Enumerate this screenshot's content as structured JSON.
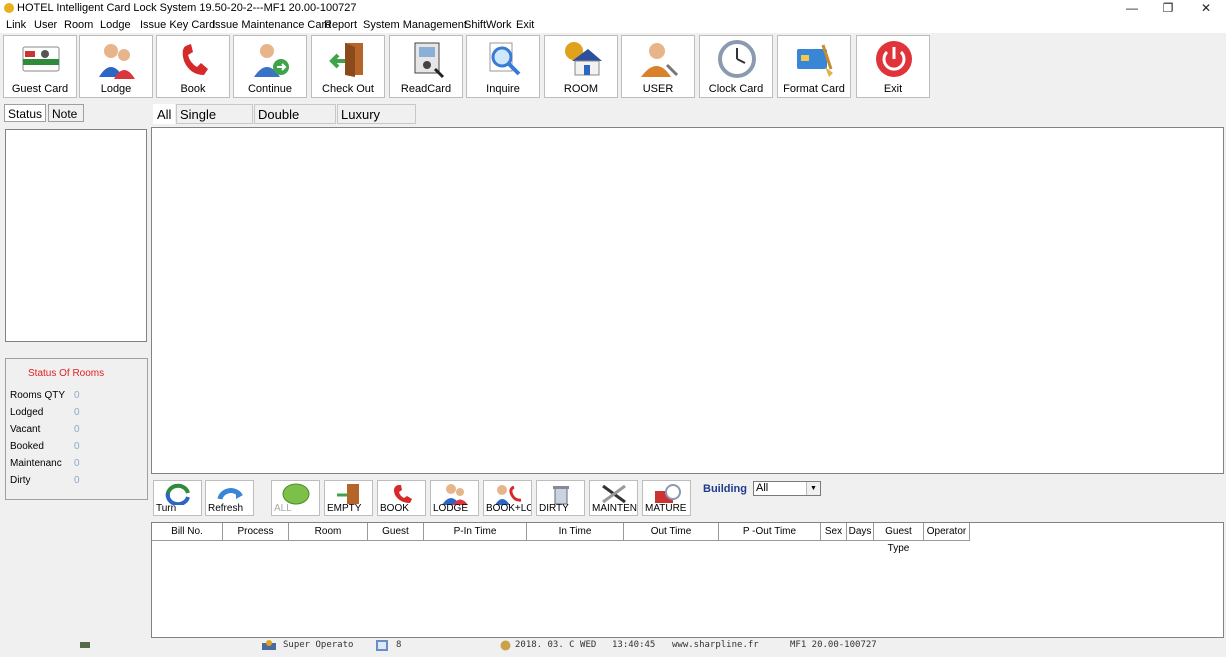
{
  "window": {
    "title": "HOTEL Intelligent Card Lock System 19.50-20-2---MF1 20.00-100727",
    "minimize": "—",
    "restore": "❐",
    "close": "✕"
  },
  "menu": [
    "Link",
    "User",
    "Room",
    "Lodge",
    "Issue Key Card",
    "Issue Maintenance Card",
    "Report",
    "System Management",
    "ShiftWork",
    "Exit"
  ],
  "toolbar": [
    "Guest Card",
    "Lodge",
    "Book",
    "Continue",
    "Check Out",
    "ReadCard",
    "Inquire",
    "ROOM",
    "USER",
    "Clock Card",
    "Format Card",
    "Exit"
  ],
  "left_tabs": [
    "Status",
    "Note"
  ],
  "room_tabs": [
    "All",
    "Single Room",
    "Double Room",
    "Luxury Room"
  ],
  "status_panel": {
    "title": "Status Of Rooms",
    "rows": [
      {
        "label": "Rooms QTY",
        "value": "0"
      },
      {
        "label": "Lodged",
        "value": "0"
      },
      {
        "label": "Vacant",
        "value": "0"
      },
      {
        "label": "Booked",
        "value": "0"
      },
      {
        "label": "Maintenanc",
        "value": "0"
      },
      {
        "label": "Dirty",
        "value": "0"
      }
    ]
  },
  "filter_buttons": [
    "Turn",
    "Refresh",
    "ALL",
    "EMPTY",
    "BOOK",
    "LODGE",
    "BOOK+LC",
    "DIRTY",
    "MAINTEN",
    "MATURE"
  ],
  "building": {
    "label": "Building",
    "value": "All"
  },
  "grid_columns": [
    "Bill No.",
    "Process",
    "Room",
    "Guest",
    "P-In Time",
    "In Time",
    "Out Time",
    "P -Out Time",
    "Sex",
    "Days",
    "Guest Type",
    "Operator"
  ],
  "statusbar": {
    "operator": "Super Operato",
    "count": "8",
    "date": "2018. 03. C WED",
    "time": "13:40:45",
    "website": "www.sharpline.fr",
    "version": "MF1 20.00-100727"
  },
  "colors": {
    "status_title": "#e02020",
    "zero_value": "#8fa9c8",
    "building_label": "#1f3b8c"
  }
}
